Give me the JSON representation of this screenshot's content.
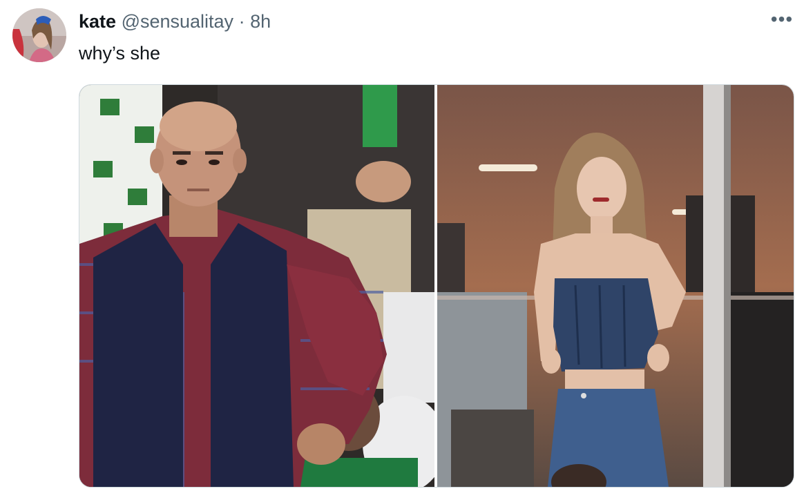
{
  "tweet": {
    "author_name": "kate",
    "handle": "@sensualitay",
    "separator": " · ",
    "time": "8h",
    "text": "why’s she",
    "more_icon": "ellipsis-icon"
  },
  "media": {
    "images": [
      {
        "name": "photo-left",
        "subject": "bald-man-frustrated-cricket-fan"
      },
      {
        "name": "photo-right",
        "subject": "woman-in-stadium-suite"
      }
    ]
  },
  "colors": {
    "text_primary": "#0f1419",
    "text_secondary": "#536471",
    "border": "#cfd9de"
  }
}
